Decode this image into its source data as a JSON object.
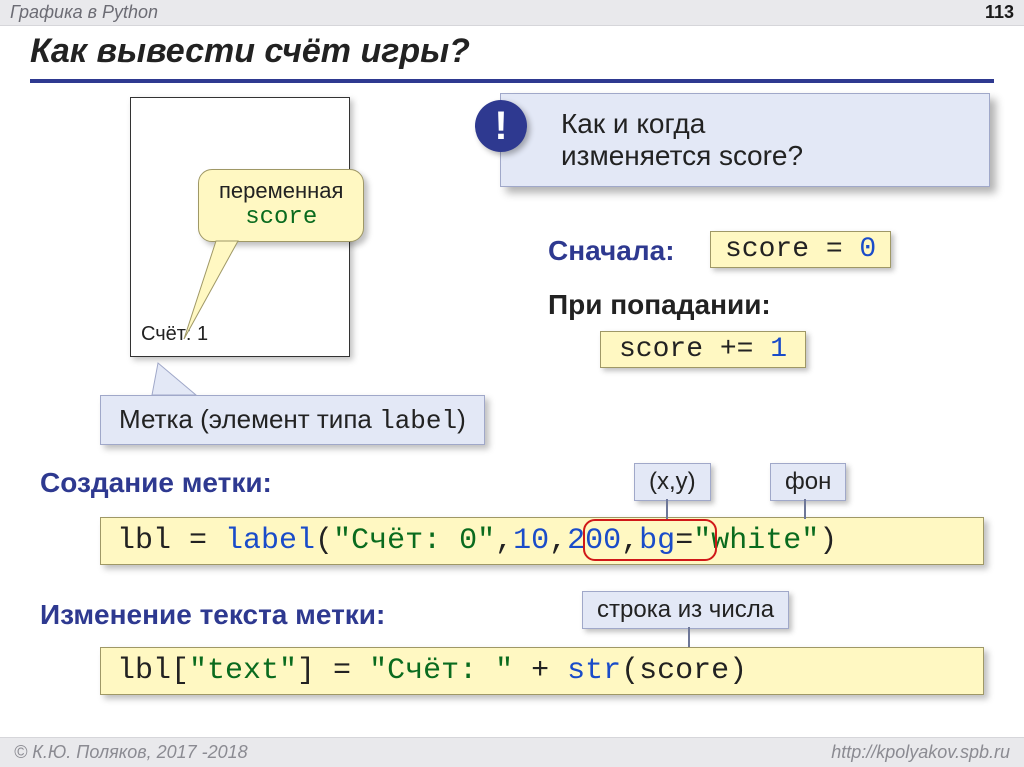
{
  "header": {
    "topic": "Графика в Python",
    "pagenum": "113"
  },
  "title": "Как вывести счёт игры?",
  "window": {
    "scoreline": "Счёт: 1"
  },
  "tag_var": {
    "line1": "переменная",
    "line2_code": "score"
  },
  "callout": {
    "text1": "Как и когда",
    "text2": "изменяется score?"
  },
  "first": {
    "label": "Сначала:",
    "code": {
      "pre": "score = ",
      "zero": "0"
    }
  },
  "on_hit": {
    "label": "При попадании:",
    "code": {
      "pre": "score += ",
      "one": "1"
    }
  },
  "note_label": {
    "before": "Метка (элемент типа ",
    "code": "label",
    "after": ")"
  },
  "sec1": {
    "label": "Создание метки:"
  },
  "code1": {
    "p1": "lbl = ",
    "fn": "label",
    "p2": "(",
    "str": "\"Счёт: 0\"",
    "comma": ",",
    "n1": "10",
    "c2": ",",
    "n2": "200",
    "c3": ",",
    "bgkey": "bg",
    "eq": "=",
    "bgval": "\"white\"",
    "end": ")"
  },
  "pop_xy": "(x,y)",
  "pop_bg": "фон",
  "pop_str": "строка из числа",
  "sec2": {
    "label": "Изменение текста метки:"
  },
  "code2": {
    "p1": "lbl[",
    "key": "\"text\"",
    "p2": "] = ",
    "str": "\"Счёт: \"",
    "plus": " + ",
    "fn": "str",
    "p3": "(score)"
  },
  "footer": {
    "left": "© К.Ю. Поляков, 2017 -2018",
    "right": "http://kpolyakov.spb.ru"
  }
}
